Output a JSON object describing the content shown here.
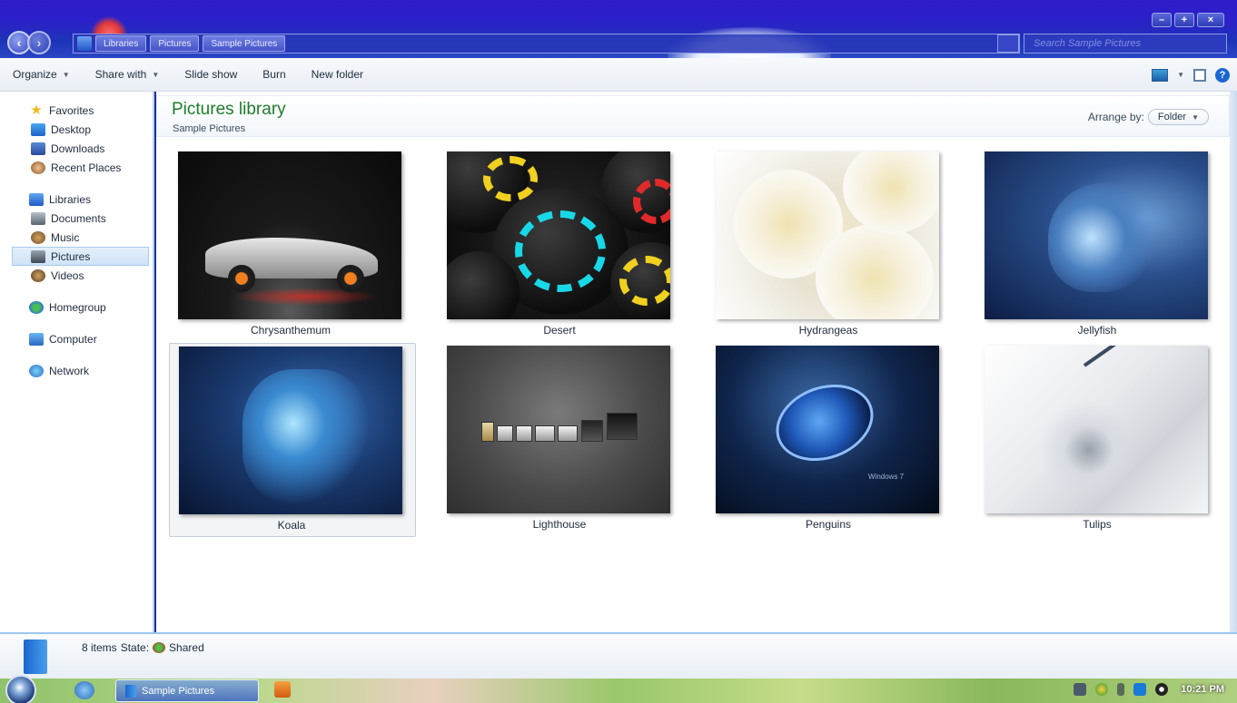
{
  "window": {
    "controls": {
      "minimize": "–",
      "maximize": "+",
      "close": "×"
    }
  },
  "address": {
    "breadcrumbs": [
      "Libraries",
      "Pictures",
      "Sample Pictures"
    ],
    "search_placeholder": "Search Sample Pictures"
  },
  "toolbar": {
    "organize": "Organize",
    "share_with": "Share with",
    "slide_show": "Slide show",
    "burn": "Burn",
    "new_folder": "New folder",
    "help": "?"
  },
  "sidebar": {
    "favorites": {
      "label": "Favorites",
      "items": [
        {
          "label": "Desktop",
          "icon": "desktop-icon"
        },
        {
          "label": "Downloads",
          "icon": "downloads-icon"
        },
        {
          "label": "Recent Places",
          "icon": "recent-places-icon"
        }
      ]
    },
    "libraries": {
      "label": "Libraries",
      "items": [
        {
          "label": "Documents",
          "icon": "documents-icon"
        },
        {
          "label": "Music",
          "icon": "music-icon"
        },
        {
          "label": "Pictures",
          "icon": "pictures-icon",
          "selected": true
        },
        {
          "label": "Videos",
          "icon": "videos-icon"
        }
      ]
    },
    "homegroup": "Homegroup",
    "computer": "Computer",
    "network": "Network"
  },
  "library": {
    "title": "Pictures library",
    "subtitle": "Sample Pictures",
    "arrange_label": "Arrange by:",
    "arrange_value": "Folder"
  },
  "files": [
    {
      "name": "Chrysanthemum"
    },
    {
      "name": "Desert"
    },
    {
      "name": "Hydrangeas"
    },
    {
      "name": "Jellyfish"
    },
    {
      "name": "Koala",
      "selected": true
    },
    {
      "name": "Lighthouse"
    },
    {
      "name": "Penguins"
    },
    {
      "name": "Tulips"
    }
  ],
  "thumb_text": {
    "penguins_caption": "Windows 7"
  },
  "details": {
    "count": "8 items",
    "state_label": "State:",
    "state_value": "Shared"
  },
  "taskbar": {
    "task_label": "Sample Pictures",
    "clock": "10:21 PM"
  },
  "colors": {
    "title_bar": "#2b20c9",
    "library_title": "#1e7d2a",
    "selection": "#cfe3f7"
  }
}
